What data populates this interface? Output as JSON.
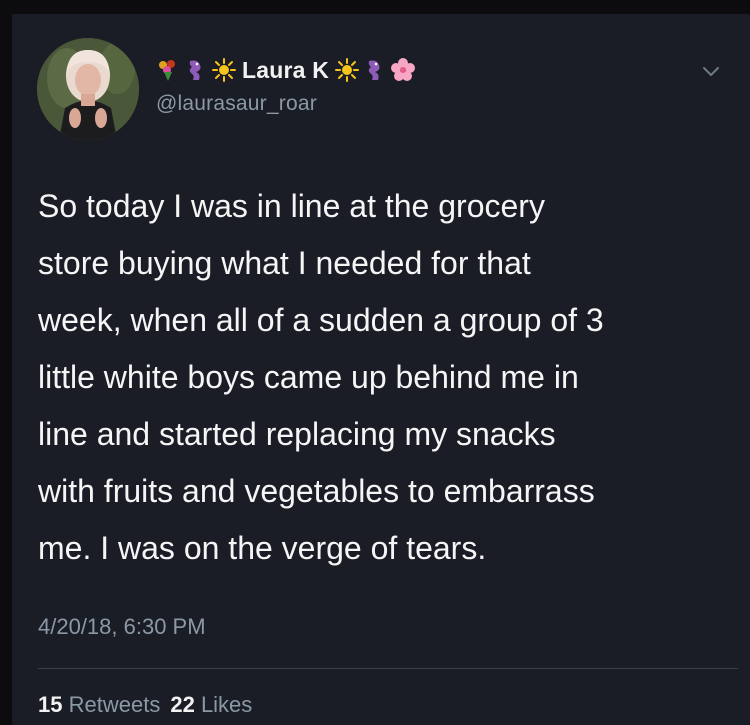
{
  "tweet": {
    "author": {
      "display_name": "Laura K",
      "handle": "@laurasaur_roar",
      "name_emojis_left": [
        "bouquet-emoji",
        "dragon-emoji",
        "sun-emoji"
      ],
      "name_emojis_right": [
        "sun-emoji",
        "dragon-emoji",
        "cherry-blossom-emoji"
      ]
    },
    "text_lines": [
      "So today I was in line at the grocery",
      "store buying what I needed for that",
      "week, when all of a sudden a group of 3",
      "little white boys came up behind me in",
      "line and started replacing my snacks",
      "with fruits and vegetables to embarrass",
      "me. I was on the verge of tears."
    ],
    "timestamp": "4/20/18, 6:30 PM",
    "stats": {
      "retweets_count": "15",
      "retweets_label": "Retweets",
      "likes_count": "22",
      "likes_label": "Likes"
    },
    "menu_icon": "chevron-down-icon"
  },
  "colors": {
    "background": "#1a1d26",
    "text": "#f5f5f5",
    "secondary_text": "#8b98a5"
  }
}
